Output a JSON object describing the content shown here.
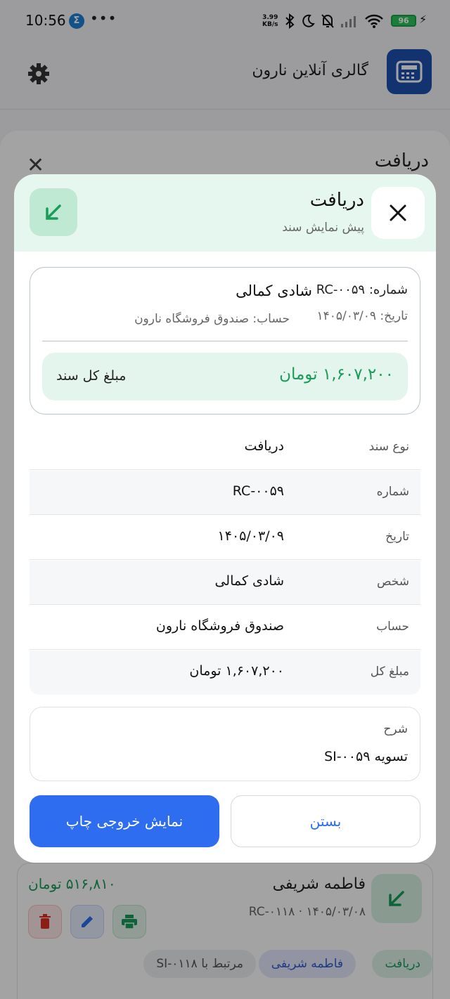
{
  "status_bar": {
    "time": "10:56",
    "app_badge": "Σ",
    "dots": "•••",
    "net_speed_value": "3.99",
    "net_speed_unit": "KB/s",
    "battery": "96"
  },
  "app_header": {
    "title": "گالری آنلاین نارون"
  },
  "background_sheet": {
    "title": "دریافت",
    "list_item": {
      "name": "فاطمه شریفی",
      "subtitle": "RC-۰۱۱۸ · ۱۴۰۵/۰۳/۰۸",
      "amount": "۵۱۶,۸۱۰ تومان",
      "chip_type": "دریافت",
      "chip_person": "فاطمه شریفی",
      "chip_related": "مرتبط با SI-۰۱۱۸"
    }
  },
  "dialog": {
    "title": "دریافت",
    "subtitle": "پیش نمایش سند",
    "summary": {
      "number": "شماره: RC-۰۰۵۹",
      "person": "شادی کمالی",
      "date": "تاریخ: ۱۴۰۵/۰۳/۰۹",
      "account": "حساب: صندوق فروشگاه نارون",
      "total_label": "مبلغ کل سند",
      "total_amount": "۱,۶۰۷,۲۰۰ تومان"
    },
    "rows": [
      {
        "label": "نوع سند",
        "value": "دریافت"
      },
      {
        "label": "شماره",
        "value": "RC-۰۰۵۹"
      },
      {
        "label": "تاریخ",
        "value": "۱۴۰۵/۰۳/۰۹"
      },
      {
        "label": "شخص",
        "value": "شادی کمالی"
      },
      {
        "label": "حساب",
        "value": "صندوق فروشگاه نارون"
      },
      {
        "label": "مبلغ کل",
        "value": "۱,۶۰۷,۲۰۰ تومان"
      }
    ],
    "description": {
      "label": "شرح",
      "value": "تسویه SI-۰۰۵۹"
    },
    "buttons": {
      "print": "نمایش خروجی چاپ",
      "close": "بستن"
    }
  },
  "colors": {
    "accent_green": "#1a9c5a",
    "primary_blue": "#2e6cf0",
    "header_tint": "#e6f7ef"
  }
}
